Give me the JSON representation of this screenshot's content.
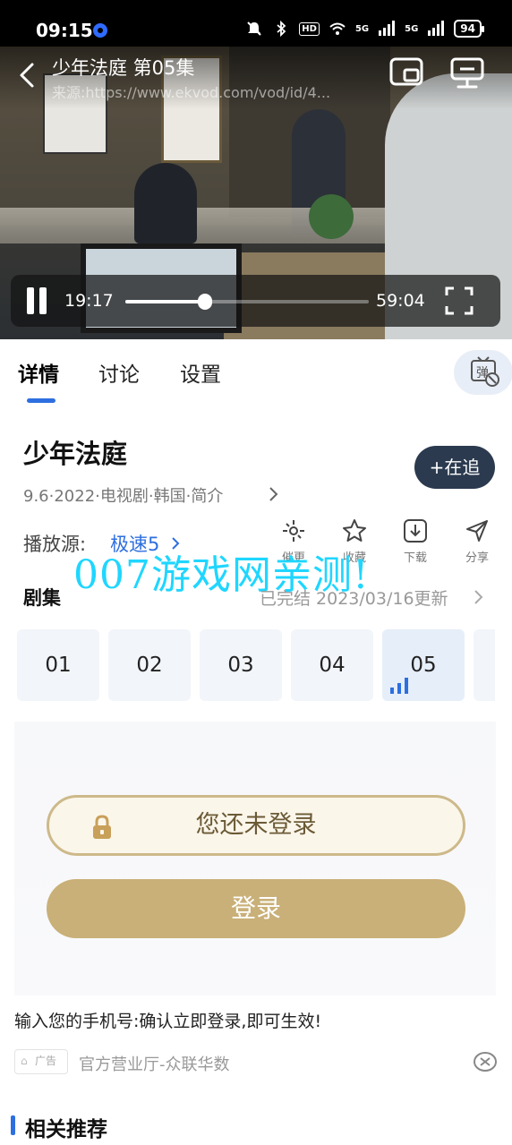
{
  "status_bar": {
    "time": "09:15",
    "hd_label": "HD",
    "network_1": "5G",
    "network_2": "5G",
    "battery": "94"
  },
  "player": {
    "title": "少年法庭 第05集",
    "source": "来源:https://www.ekvod.com/vod/id/4...",
    "current_time": "19:17",
    "total_time": "59:04",
    "progress": 0.327,
    "icons": [
      "back-icon",
      "pip-icon",
      "cast-icon",
      "pause-icon",
      "fullscreen-icon"
    ]
  },
  "tabs": [
    {
      "label": "详情",
      "active": true
    },
    {
      "label": "讨论",
      "active": false
    },
    {
      "label": "设置",
      "active": false
    }
  ],
  "danmaku_icon_text": "弹",
  "show": {
    "title": "少年法庭",
    "meta": "9.6·2022·电视剧·韩国·简介",
    "follow_label": "+在追"
  },
  "source_row": {
    "label": "播放源:",
    "value": "极速5"
  },
  "actions": [
    {
      "label": "催更",
      "icon": "urge-update-icon"
    },
    {
      "label": "收藏",
      "icon": "star-icon"
    },
    {
      "label": "下载",
      "icon": "download-icon"
    },
    {
      "label": "分享",
      "icon": "share-icon"
    }
  ],
  "watermark": "007游戏网亲测!",
  "episodes": {
    "title": "剧集",
    "status": "已完结  2023/03/16更新",
    "items": [
      "01",
      "02",
      "03",
      "04",
      "05"
    ],
    "current": "05"
  },
  "ad": {
    "not_logged_text": "您还未登录",
    "login_button": "登录",
    "promo_text": "输入您的手机号:确认立即登录,即可生效!",
    "badge": "广告",
    "source": "官方营业厅-众联华数"
  },
  "related": {
    "title": "相关推荐"
  },
  "colors": {
    "accent_blue": "#2e6fe0",
    "follow_button": "#2b3a4e",
    "gold": "#c9b078",
    "watermark": "#1fd6ff"
  }
}
